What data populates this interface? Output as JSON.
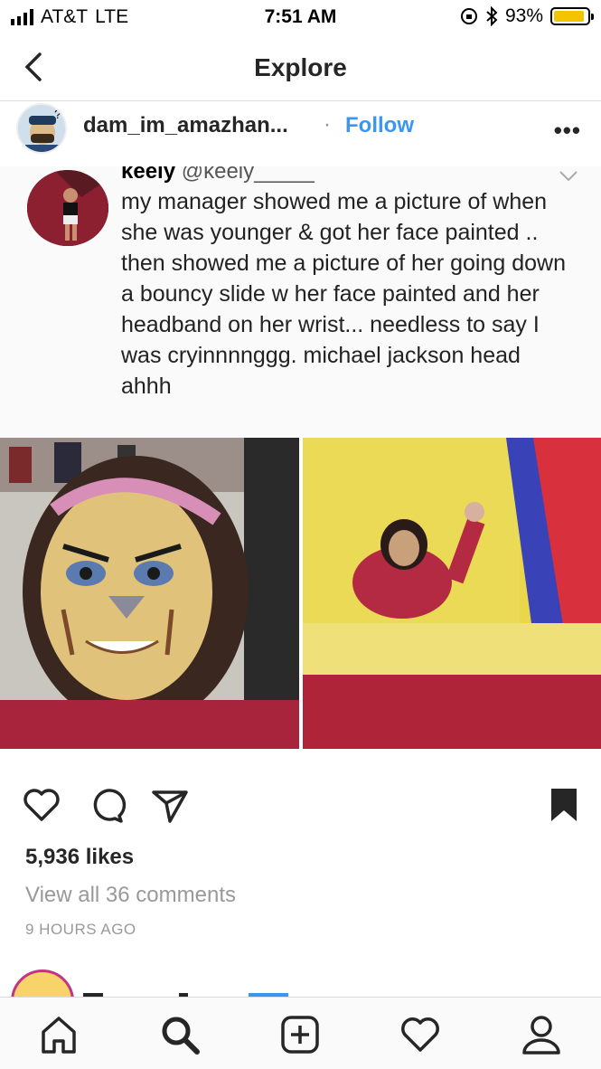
{
  "status_bar": {
    "carrier": "AT&T",
    "network": "LTE",
    "time": "7:51 AM",
    "battery": "93%",
    "battery_level": 0.93
  },
  "nav": {
    "title": "Explore",
    "back_icon": "chevron-left-icon"
  },
  "post": {
    "username": "dam_im_amazhan...",
    "separator": "·",
    "follow_label": "Follow",
    "more_icon": "ellipsis-icon",
    "tweet": {
      "display_name": "keely",
      "handle": "@keely_____",
      "text": "my manager showed me a picture of when she was younger & got her face painted .. then showed me a picture of her going down a bouncy slide w her face painted and her headband on her wrist... needless to say I was cryinnnnggg. michael jackson head ahhh"
    },
    "likes": "5,936 likes",
    "comments_link": "View all 36 comments",
    "time_ago": "9 HOURS AGO"
  },
  "actions": {
    "icons": [
      "heart-icon",
      "comment-icon",
      "share-icon",
      "bookmark-icon"
    ]
  },
  "tabbar": {
    "icons": [
      "home-icon",
      "search-icon",
      "add-post-icon",
      "activity-icon",
      "profile-icon"
    ]
  },
  "colors": {
    "follow": "#3897f0",
    "battery": "#f5c400",
    "muted": "#999999"
  }
}
